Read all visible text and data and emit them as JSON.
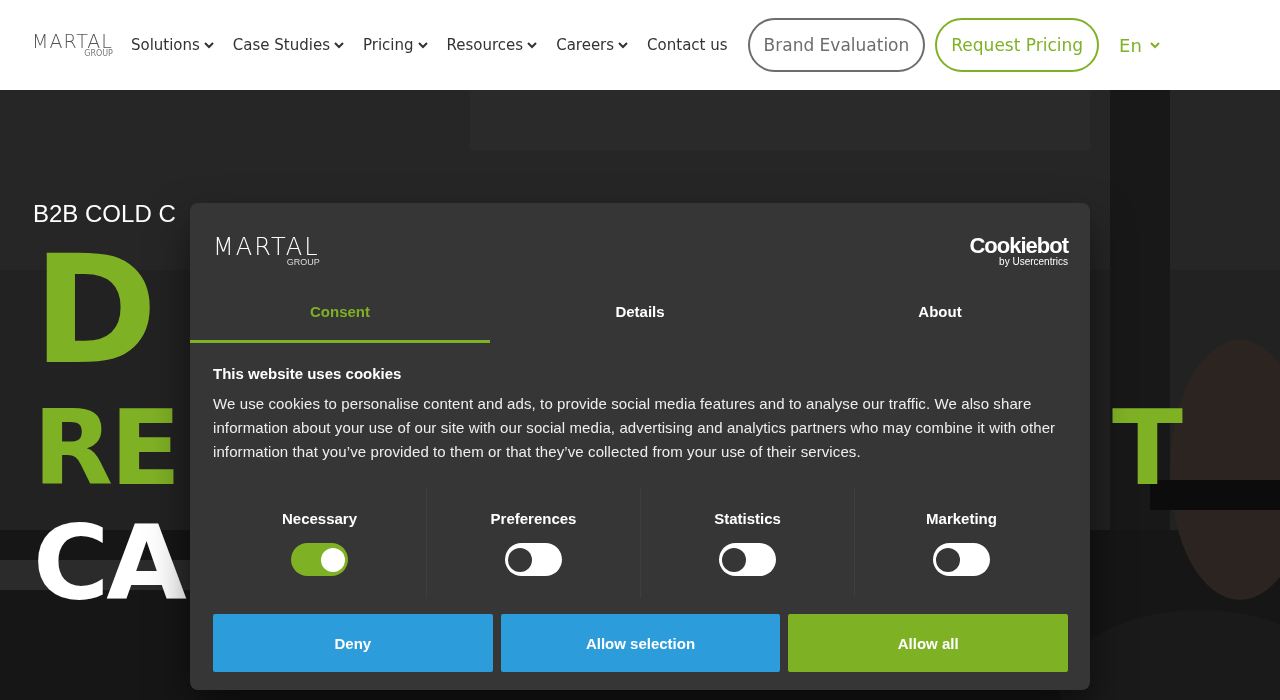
{
  "header": {
    "logo": {
      "name": "MARTAL",
      "sub": "GROUP"
    },
    "nav": [
      {
        "label": "Solutions",
        "dropdown": true
      },
      {
        "label": "Case Studies",
        "dropdown": true
      },
      {
        "label": "Pricing",
        "dropdown": true
      },
      {
        "label": "Resources",
        "dropdown": true
      },
      {
        "label": "Careers",
        "dropdown": true
      },
      {
        "label": "Contact us",
        "dropdown": false
      }
    ],
    "buttons": [
      {
        "label": "Brand Evaluation",
        "kind": "outline"
      },
      {
        "label": "Request Pricing",
        "kind": "accent"
      }
    ],
    "language": "En"
  },
  "hero": {
    "eyebrow": "B2B COLD C",
    "lines": [
      {
        "texts": [
          "D"
        ],
        "color": "#7fb125"
      },
      {
        "texts": [
          "RE",
          "T"
        ],
        "color": "#7fb125"
      },
      {
        "texts": [
          "CA"
        ],
        "color": "#ffffff"
      }
    ]
  },
  "cookie_dialog": {
    "logo": {
      "name": "MARTAL",
      "sub": "GROUP"
    },
    "brand": {
      "name": "Cookiebot",
      "sub": "by Usercentrics"
    },
    "tabs": [
      {
        "label": "Consent",
        "selected": true
      },
      {
        "label": "Details",
        "selected": false
      },
      {
        "label": "About",
        "selected": false
      }
    ],
    "title": "This website uses cookies",
    "body": "We use cookies to personalise content and ads, to provide social media features and to analyse our traffic. We also share information about your use of our site with our social media, advertising and analytics partners who may combine it with other information that you’ve provided to them or that they’ve collected from your use of their services.",
    "categories": [
      {
        "label": "Necessary",
        "checked": true
      },
      {
        "label": "Preferences",
        "checked": false
      },
      {
        "label": "Statistics",
        "checked": false
      },
      {
        "label": "Marketing",
        "checked": false
      }
    ],
    "buttons": [
      {
        "label": "Deny",
        "kind": "secondary"
      },
      {
        "label": "Allow selection",
        "kind": "secondary"
      },
      {
        "label": "Allow all",
        "kind": "primary"
      }
    ]
  }
}
